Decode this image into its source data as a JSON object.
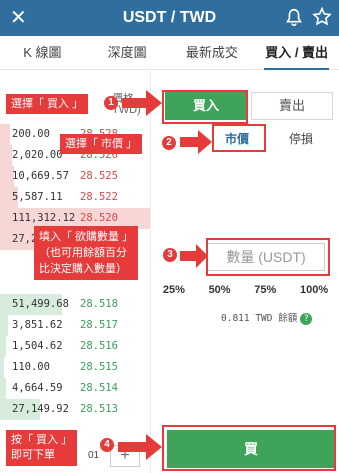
{
  "header": {
    "title": "USDT / TWD",
    "close_icon": "close-icon",
    "bell_icon": "bell-icon",
    "star_icon": "star-icon"
  },
  "tabs": [
    {
      "label": "K 線圖"
    },
    {
      "label": "深度圖"
    },
    {
      "label": "最新成交"
    },
    {
      "label": "買入 / 賣出"
    }
  ],
  "book": {
    "price_head": "價格",
    "price_unit": "TWD)",
    "asks": [
      {
        "qty": "200.00",
        "price": "28.528"
      },
      {
        "qty": "2,020.00",
        "price": "28.526"
      },
      {
        "qty": "10,669.57",
        "price": "28.525"
      },
      {
        "qty": "5,587.11",
        "price": "28.522"
      },
      {
        "qty": "111,312.12",
        "price": "28.520"
      },
      {
        "qty": "27,2",
        "price": ""
      }
    ],
    "bids": [
      {
        "qty": "51,499.68",
        "price": "28.518"
      },
      {
        "qty": "3,851.62",
        "price": "28.517"
      },
      {
        "qty": "1,504.62",
        "price": "28.516"
      },
      {
        "qty": "110.00",
        "price": "28.515"
      },
      {
        "qty": "4,664.59",
        "price": "28.514"
      },
      {
        "qty": "27,149.92",
        "price": "28.513"
      }
    ],
    "page_num": "01"
  },
  "panel": {
    "buy_label": "買入",
    "sell_label": "賣出",
    "order_types": [
      "市價",
      "停損"
    ],
    "qty_placeholder": "數量 (USDT)",
    "percents": [
      "25%",
      "50%",
      "75%",
      "100%"
    ],
    "balance": "0.811 TWD 餘額",
    "submit_label": "買"
  },
  "annotations": {
    "step1": "選擇「 買入 」",
    "step2": "選擇「 市價 」",
    "step3": "填入「 欲購數量 」\n（也可用餘額百分\n比決定購入數量）",
    "step4": "按「 買入 」\n即可下單",
    "nums": [
      "1",
      "2",
      "3",
      "4"
    ]
  },
  "colors": {
    "header": "#2f6e9e",
    "buy_green": "#3fa45a",
    "ask_red": "#d34a4a",
    "annotation_red": "#e53b3b"
  }
}
